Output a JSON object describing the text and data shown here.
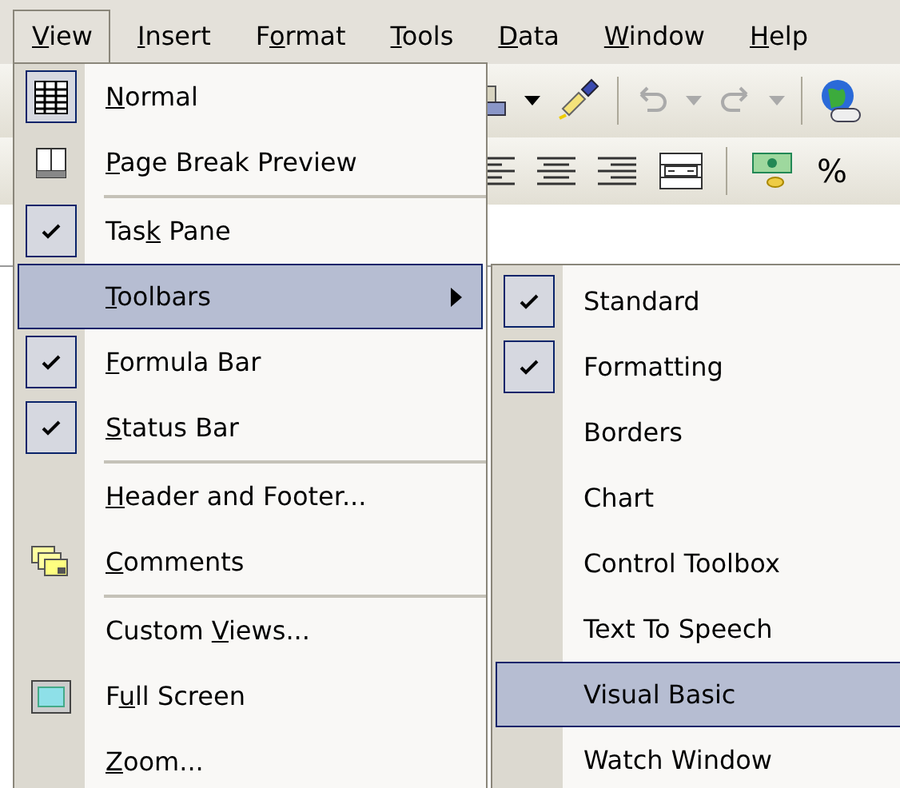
{
  "menu_bar": [
    {
      "key": "V",
      "post": "iew",
      "selected": true
    },
    {
      "key": "I",
      "post": "nsert",
      "selected": false
    },
    {
      "pre": "F",
      "key": "o",
      "post": "rmat",
      "selected": false
    },
    {
      "key": "T",
      "post": "ools",
      "selected": false
    },
    {
      "key": "D",
      "post": "ata",
      "selected": false
    },
    {
      "key": "W",
      "post": "indow",
      "selected": false
    },
    {
      "key": "H",
      "post": "elp",
      "selected": false
    }
  ],
  "toolbar": {
    "percent_label": "%"
  },
  "view_menu": [
    {
      "kind": "item",
      "key": "N",
      "post": "ormal",
      "checked": true,
      "selected": false
    },
    {
      "kind": "item",
      "key": "P",
      "post": "age Break Preview",
      "checked": false,
      "selected": false
    },
    {
      "kind": "separator"
    },
    {
      "kind": "item",
      "pre": "Tas",
      "key": "k",
      "post": " Pane",
      "checked": true,
      "selected": false
    },
    {
      "kind": "submenu",
      "key": "T",
      "post": "oolbars",
      "checked": false,
      "selected": true
    },
    {
      "kind": "item",
      "key": "F",
      "post": "ormula Bar",
      "checked": true,
      "selected": false
    },
    {
      "kind": "item",
      "key": "S",
      "post": "tatus Bar",
      "checked": true,
      "selected": false
    },
    {
      "kind": "separator"
    },
    {
      "kind": "item",
      "key": "H",
      "post": "eader and Footer...",
      "checked": false,
      "selected": false
    },
    {
      "kind": "item",
      "key": "C",
      "post": "omments",
      "checked": false,
      "selected": false
    },
    {
      "kind": "separator"
    },
    {
      "kind": "item",
      "pre": "Custom ",
      "key": "V",
      "post": "iews...",
      "checked": false,
      "selected": false
    },
    {
      "kind": "item",
      "pre": "F",
      "key": "u",
      "post": "ll Screen",
      "checked": false,
      "selected": false
    },
    {
      "kind": "item",
      "key": "Z",
      "post": "oom...",
      "checked": false,
      "selected": false
    }
  ],
  "toolbars_submenu": [
    {
      "label": "Standard",
      "checked": true,
      "selected": false
    },
    {
      "label": "Formatting",
      "checked": true,
      "selected": false
    },
    {
      "label": "Borders",
      "checked": false,
      "selected": false
    },
    {
      "label": "Chart",
      "checked": false,
      "selected": false
    },
    {
      "label": "Control Toolbox",
      "checked": false,
      "selected": false
    },
    {
      "label": "Text To Speech",
      "checked": false,
      "selected": false
    },
    {
      "label": "Visual Basic",
      "checked": false,
      "selected": true
    },
    {
      "label": "Watch Window",
      "checked": false,
      "selected": false
    }
  ]
}
